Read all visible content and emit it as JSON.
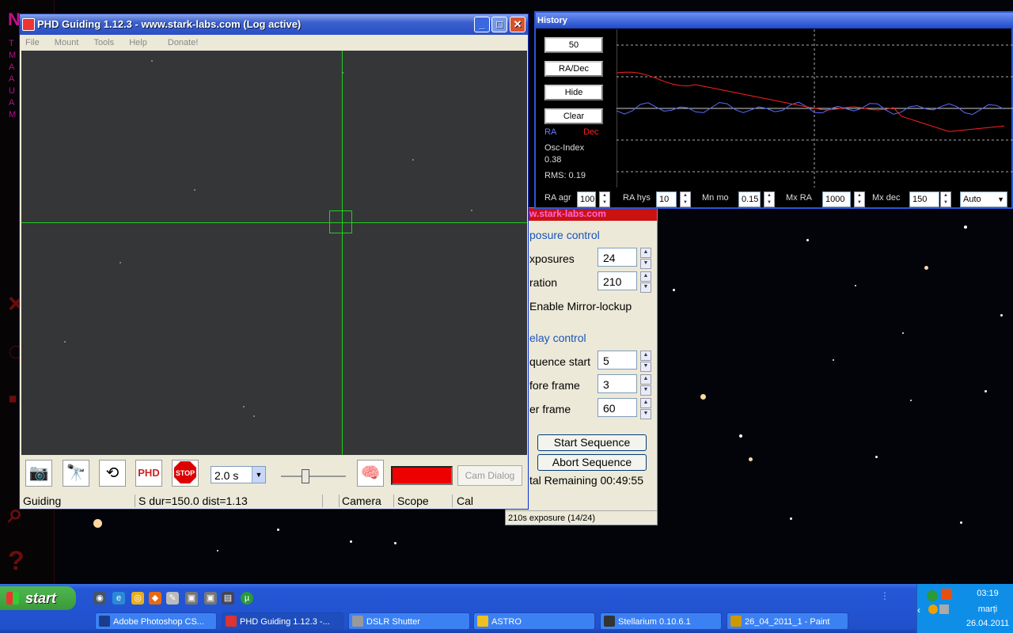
{
  "stellarium": {
    "left_letters": [
      "T",
      "M",
      "A",
      "A",
      "U",
      "A",
      "M"
    ],
    "big_letter": "N",
    "help_icon": "?"
  },
  "dslr": {
    "redbar_text": "w.stark-labs.com",
    "exposure_group": "posure control",
    "exposures_label": "xposures",
    "exposures_value": "24",
    "duration_label": "ration",
    "duration_value": "210",
    "mirror_label": "Enable Mirror-lockup",
    "delay_group": "elay control",
    "seq_start_label": "quence start",
    "seq_start_value": "5",
    "before_label": "fore frame",
    "before_value": "3",
    "after_label": "er frame",
    "after_value": "60",
    "start_btn": "Start Sequence",
    "abort_btn": "Abort Sequence",
    "remaining": "tal Remaining 00:49:55",
    "status": "210s exposure (14/24)"
  },
  "phd": {
    "title": "PHD Guiding 1.12.3  -  www.stark-labs.com (Log active)",
    "menu": [
      "File",
      "Mount",
      "Tools",
      "Help",
      "Donate!"
    ],
    "exposure": "2.0 s",
    "cam_dialog": "Cam Dialog",
    "status": {
      "state": "Guiding",
      "info": "S dur=150.0 dist=1.13",
      "camera": "Camera",
      "scope": "Scope",
      "cal": "Cal"
    }
  },
  "history": {
    "title": "History",
    "btn_50": "50",
    "btn_radec": "RA/Dec",
    "btn_hide": "Hide",
    "btn_clear": "Clear",
    "ra_label": "RA",
    "dec_label": "Dec",
    "osc_label": "Osc-Index",
    "osc_value": "0.38",
    "rms": "RMS: 0.19",
    "ra_color": "#5a6cff",
    "dec_color": "#ff2020",
    "controls": {
      "ra_agr_label": "RA agr",
      "ra_agr_value": "100",
      "ra_hys_label": "RA hys",
      "ra_hys_value": "10",
      "mn_mo_label": "Mn mo",
      "mn_mo_value": "0.15",
      "mx_ra_label": "Mx RA",
      "mx_ra_value": "1000",
      "mx_dec_label": "Mx dec",
      "mx_dec_value": "150",
      "mode_value": "Auto"
    }
  },
  "taskbar": {
    "start": "start",
    "tasks": [
      {
        "label": "Adobe Photoshop CS...",
        "color": "#1b3c8c"
      },
      {
        "label": "PHD Guiding 1.12.3 -...",
        "color": "#d33"
      },
      {
        "label": "DSLR Shutter",
        "color": "#999"
      },
      {
        "label": "ASTRO",
        "color": "#f0c020"
      },
      {
        "label": "Stellarium 0.10.6.1",
        "color": "#333"
      },
      {
        "label": "26_04_2011_1 - Paint",
        "color": "#c90"
      }
    ],
    "time": "03:19",
    "day": "marți",
    "date": "26.04.2011"
  }
}
